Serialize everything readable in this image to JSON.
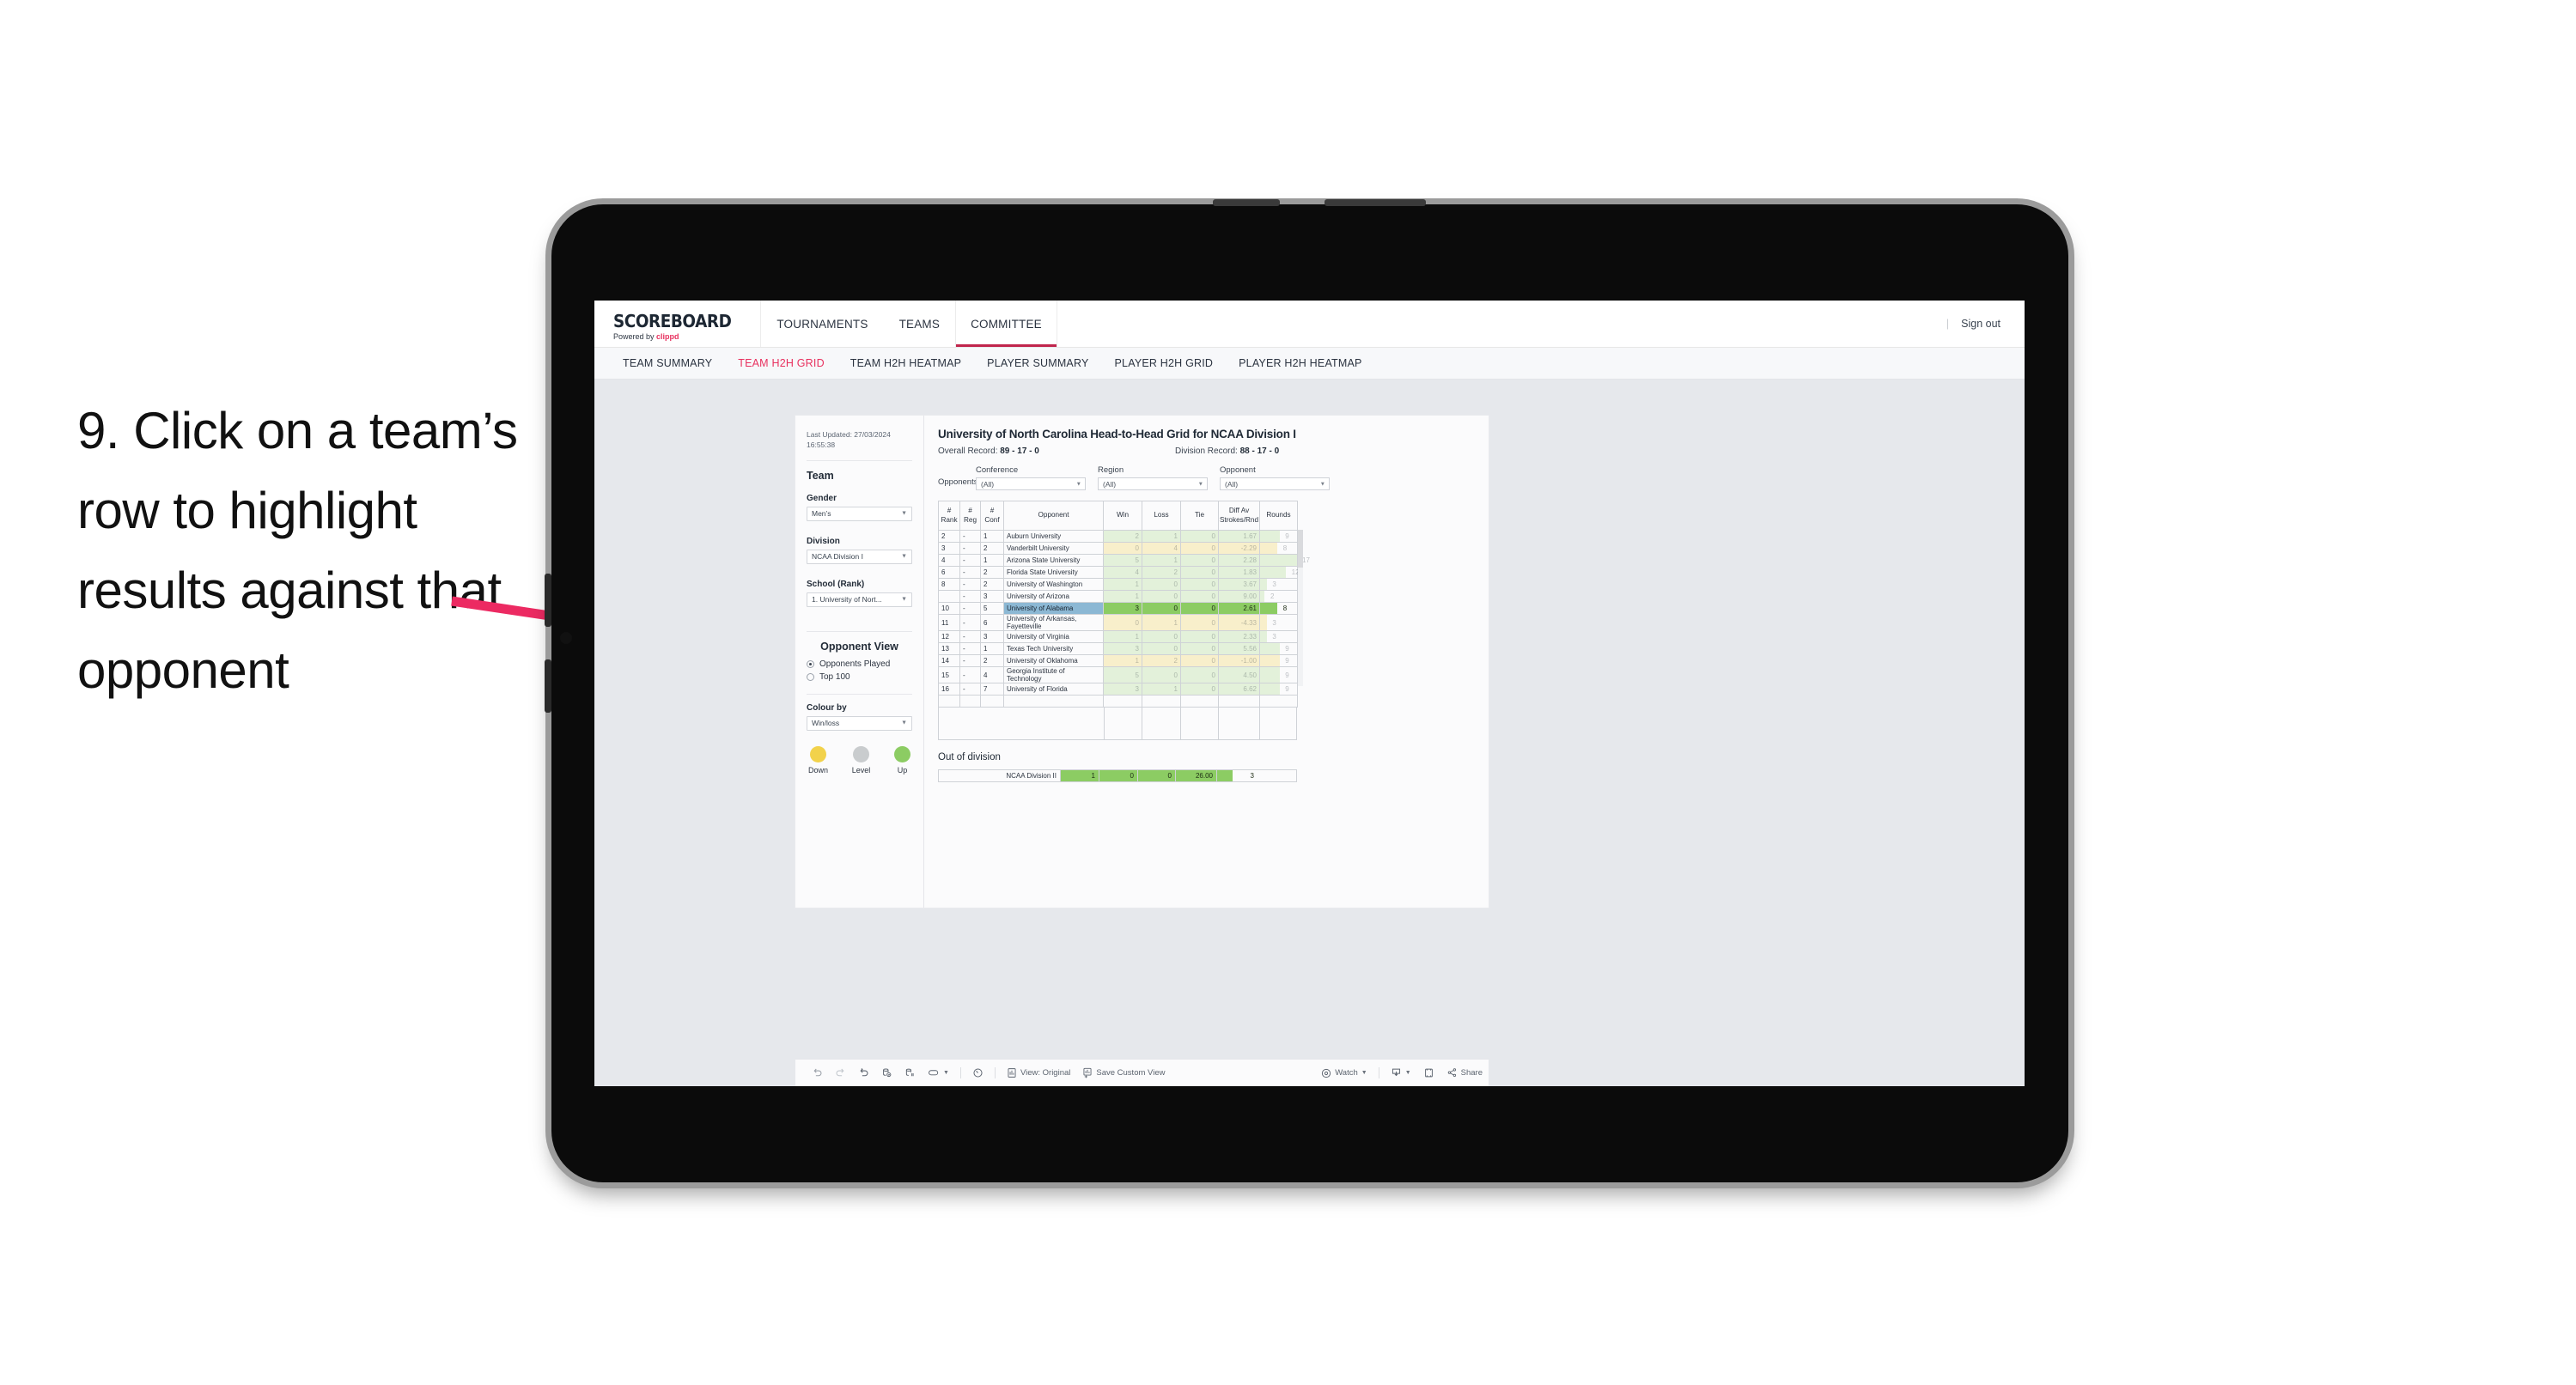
{
  "annotation": {
    "text": "9. Click on a team’s row to highlight results against that opponent",
    "arrow_color": "#ec2a62"
  },
  "app": {
    "brand": {
      "title": "SCOREBOARD",
      "powered_prefix": "Powered by ",
      "powered_brand": "clippd"
    },
    "top_nav": [
      {
        "label": "TOURNAMENTS",
        "active": false
      },
      {
        "label": "TEAMS",
        "active": false
      },
      {
        "label": "COMMITTEE",
        "active": true
      }
    ],
    "sign_out": "Sign out",
    "sub_tabs": [
      {
        "label": "TEAM SUMMARY",
        "active": false
      },
      {
        "label": "TEAM H2H GRID",
        "active": true
      },
      {
        "label": "TEAM H2H HEATMAP",
        "active": false
      },
      {
        "label": "PLAYER SUMMARY",
        "active": false
      },
      {
        "label": "PLAYER H2H GRID",
        "active": false
      },
      {
        "label": "PLAYER H2H HEATMAP",
        "active": false
      }
    ],
    "accent_color": "#e8315f"
  },
  "sidebar": {
    "last_updated_line1": "Last Updated: 27/03/2024",
    "last_updated_line2": "16:55:38",
    "team_heading": "Team",
    "gender_label": "Gender",
    "gender_value": "Men’s",
    "division_label": "Division",
    "division_value": "NCAA Division I",
    "school_label": "School (Rank)",
    "school_value": "1. University of Nort...",
    "opponent_view_heading": "Opponent View",
    "opponent_view_options": [
      {
        "label": "Opponents Played",
        "selected": true
      },
      {
        "label": "Top 100",
        "selected": false
      }
    ],
    "colour_by_label": "Colour by",
    "colour_by_value": "Win/loss",
    "legend": [
      {
        "label": "Down",
        "color": "#f2d24b"
      },
      {
        "label": "Level",
        "color": "#c9ccce"
      },
      {
        "label": "Up",
        "color": "#8ccc63"
      }
    ]
  },
  "viz": {
    "title": "University of North Carolina Head-to-Head Grid for NCAA Division I",
    "overall_record_label": "Overall Record: ",
    "overall_record_value": "89 - 17 - 0",
    "division_record_label": "Division Record: ",
    "division_record_value": "88 - 17 - 0",
    "opponents_label": "Opponents:",
    "filters": [
      {
        "label": "Conference",
        "value": "(All)"
      },
      {
        "label": "Region",
        "value": "(All)"
      },
      {
        "label": "Opponent",
        "value": "(All)"
      }
    ],
    "columns": [
      "# Rank",
      "# Reg",
      "# Conf",
      "Opponent",
      "Win",
      "Loss",
      "Tie",
      "Diff Av Strokes/Rnd",
      "Rounds"
    ],
    "out_of_division_title": "Out of division",
    "out_of_division_row": {
      "label": "NCAA Division II",
      "win": "1",
      "loss": "0",
      "tie": "0",
      "diff": "26.00",
      "rounds": "3"
    }
  },
  "chart_data": {
    "type": "table",
    "title": "University of North Carolina Head-to-Head Grid for NCAA Division I",
    "columns": [
      "#Rank",
      "#Reg",
      "#Conf",
      "Opponent",
      "Win",
      "Loss",
      "Tie",
      "Diff Av Strokes/Rnd",
      "Rounds"
    ],
    "selected_row": "University of Alabama",
    "rows": [
      {
        "rank": "2",
        "reg": "-",
        "conf": "1",
        "opponent": "Auburn University",
        "win": "2",
        "loss": "1",
        "tie": "0",
        "diff": "1.67",
        "rounds": "9",
        "state": "up",
        "selected": false
      },
      {
        "rank": "3",
        "reg": "-",
        "conf": "2",
        "opponent": "Vanderbilt University",
        "win": "0",
        "loss": "4",
        "tie": "0",
        "diff": "-2.29",
        "rounds": "8",
        "state": "down",
        "selected": false
      },
      {
        "rank": "4",
        "reg": "-",
        "conf": "1",
        "opponent": "Arizona State University",
        "win": "5",
        "loss": "1",
        "tie": "0",
        "diff": "2.28",
        "rounds": "17",
        "state": "up",
        "selected": false
      },
      {
        "rank": "6",
        "reg": "-",
        "conf": "2",
        "opponent": "Florida State University",
        "win": "4",
        "loss": "2",
        "tie": "0",
        "diff": "1.83",
        "rounds": "12",
        "state": "up",
        "selected": false
      },
      {
        "rank": "8",
        "reg": "-",
        "conf": "2",
        "opponent": "University of Washington",
        "win": "1",
        "loss": "0",
        "tie": "0",
        "diff": "3.67",
        "rounds": "3",
        "state": "up",
        "selected": false
      },
      {
        "rank": "",
        "reg": "-",
        "conf": "3",
        "opponent": "University of Arizona",
        "win": "1",
        "loss": "0",
        "tie": "0",
        "diff": "9.00",
        "rounds": "2",
        "state": "up",
        "selected": false
      },
      {
        "rank": "10",
        "reg": "-",
        "conf": "5",
        "opponent": "University of Alabama",
        "win": "3",
        "loss": "0",
        "tie": "0",
        "diff": "2.61",
        "rounds": "8",
        "state": "up",
        "selected": true
      },
      {
        "rank": "11",
        "reg": "-",
        "conf": "6",
        "opponent": "University of Arkansas, Fayetteville",
        "win": "0",
        "loss": "1",
        "tie": "0",
        "diff": "-4.33",
        "rounds": "3",
        "state": "down",
        "selected": false
      },
      {
        "rank": "12",
        "reg": "-",
        "conf": "3",
        "opponent": "University of Virginia",
        "win": "1",
        "loss": "0",
        "tie": "0",
        "diff": "2.33",
        "rounds": "3",
        "state": "up",
        "selected": false
      },
      {
        "rank": "13",
        "reg": "-",
        "conf": "1",
        "opponent": "Texas Tech University",
        "win": "3",
        "loss": "0",
        "tie": "0",
        "diff": "5.56",
        "rounds": "9",
        "state": "up",
        "selected": false
      },
      {
        "rank": "14",
        "reg": "-",
        "conf": "2",
        "opponent": "University of Oklahoma",
        "win": "1",
        "loss": "2",
        "tie": "0",
        "diff": "-1.00",
        "rounds": "9",
        "state": "down",
        "selected": false
      },
      {
        "rank": "15",
        "reg": "-",
        "conf": "4",
        "opponent": "Georgia Institute of Technology",
        "win": "5",
        "loss": "0",
        "tie": "0",
        "diff": "4.50",
        "rounds": "9",
        "state": "up",
        "selected": false
      },
      {
        "rank": "16",
        "reg": "-",
        "conf": "7",
        "opponent": "University of Florida",
        "win": "3",
        "loss": "1",
        "tie": "0",
        "diff": "6.62",
        "rounds": "9",
        "state": "up",
        "selected": false
      }
    ],
    "out_of_division": [
      {
        "label": "NCAA Division II",
        "win": "1",
        "loss": "0",
        "tie": "0",
        "diff": "26.00",
        "rounds": "3",
        "state": "up"
      }
    ],
    "colors": {
      "up": "#8ccc63",
      "down": "#f2d24b",
      "level": "#c9ccce",
      "selected_row": "#8cb8d4"
    }
  },
  "toolbar": {
    "view_label": "View: Original",
    "save_label": "Save Custom View",
    "watch_label": "Watch",
    "share_label": "Share"
  }
}
